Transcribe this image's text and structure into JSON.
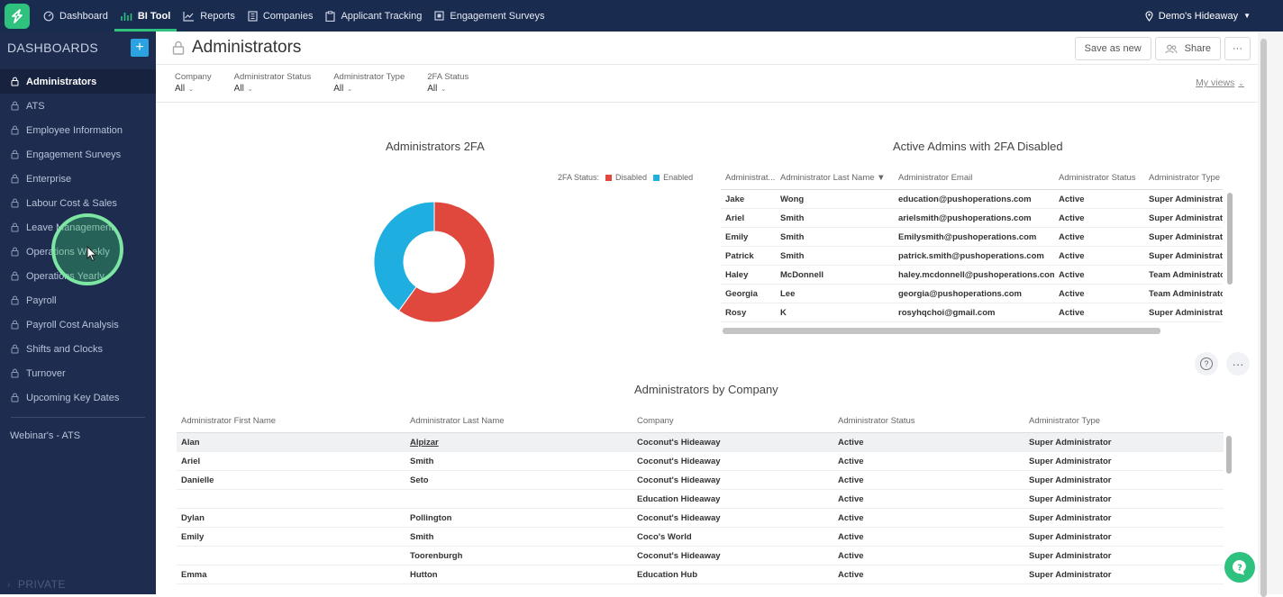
{
  "topbar": {
    "nav": [
      {
        "label": "Dashboard",
        "icon": "dashboard-icon"
      },
      {
        "label": "BI Tool",
        "icon": "bar-chart-icon",
        "active": true
      },
      {
        "label": "Reports",
        "icon": "line-chart-icon"
      },
      {
        "label": "Companies",
        "icon": "building-icon"
      },
      {
        "label": "Applicant Tracking",
        "icon": "clipboard-icon"
      },
      {
        "label": "Engagement Surveys",
        "icon": "survey-icon"
      }
    ],
    "org_label": "Demo's Hideaway"
  },
  "sidebar": {
    "title": "DASHBOARDS",
    "add_label": "+",
    "items": [
      {
        "label": "Administrators",
        "active": true
      },
      {
        "label": "ATS"
      },
      {
        "label": "Employee Information"
      },
      {
        "label": "Engagement Surveys"
      },
      {
        "label": "Enterprise"
      },
      {
        "label": "Labour Cost & Sales"
      },
      {
        "label": "Leave Management"
      },
      {
        "label": "Operations Weekly"
      },
      {
        "label": "Operations Yearly"
      },
      {
        "label": "Payroll"
      },
      {
        "label": "Payroll Cost Analysis"
      },
      {
        "label": "Shifts and Clocks"
      },
      {
        "label": "Turnover"
      },
      {
        "label": "Upcoming Key Dates"
      }
    ],
    "extra_item": "Webinar's - ATS",
    "private_label": "PRIVATE"
  },
  "header": {
    "title": "Administrators",
    "save_as_new": "Save as new",
    "share": "Share",
    "more": "···"
  },
  "filters": [
    {
      "label": "Company",
      "value": "All"
    },
    {
      "label": "Administrator Status",
      "value": "All"
    },
    {
      "label": "Administrator Type",
      "value": "All"
    },
    {
      "label": "2FA Status",
      "value": "All"
    }
  ],
  "my_views": "My views",
  "donut": {
    "title": "Administrators 2FA",
    "legend_title": "2FA Status:",
    "colors": {
      "Disabled": "#e0473d",
      "Enabled": "#1eaee0"
    }
  },
  "chart_data": {
    "type": "pie",
    "title": "Administrators 2FA",
    "legend_title": "2FA Status:",
    "series": [
      {
        "name": "Disabled",
        "value": 60
      },
      {
        "name": "Enabled",
        "value": 40
      }
    ],
    "donut": true,
    "legend": "top-right"
  },
  "active_admins": {
    "title": "Active Admins with 2FA Disabled",
    "columns": [
      "Administrat...",
      "Administrator Last Name ▼",
      "Administrator Email",
      "Administrator Status",
      "Administrator Type"
    ],
    "rows": [
      [
        "Jake",
        "Wong",
        "education@pushoperations.com",
        "Active",
        "Super Administrator"
      ],
      [
        "Ariel",
        "Smith",
        "arielsmith@pushoperations.com",
        "Active",
        "Super Administrator"
      ],
      [
        "Emily",
        "Smith",
        "Emilysmith@pushoperations.com",
        "Active",
        "Super Administrator"
      ],
      [
        "Patrick",
        "Smith",
        "patrick.smith@pushoperations.com",
        "Active",
        "Super Administrator"
      ],
      [
        "Haley",
        "McDonnell",
        "haley.mcdonnell@pushoperations.com",
        "Active",
        "Team Administrator"
      ],
      [
        "Georgia",
        "Lee",
        "georgia@pushoperations.com",
        "Active",
        "Team Administrator"
      ],
      [
        "Rosy",
        "K",
        "rosyhqchoi@gmail.com",
        "Active",
        "Super Administrator"
      ]
    ]
  },
  "by_company": {
    "title": "Administrators by Company",
    "columns": [
      "Administrator First Name",
      "Administrator Last Name",
      "Company",
      "Administrator Status",
      "Administrator Type"
    ],
    "rows": [
      [
        "Alan",
        "Alpizar",
        "Coconut's Hideaway",
        "Active",
        "Super Administrator"
      ],
      [
        "Ariel",
        "Smith",
        "Coconut's Hideaway",
        "Active",
        "Super Administrator"
      ],
      [
        "Danielle",
        "Seto",
        "Coconut's Hideaway",
        "Active",
        "Super Administrator"
      ],
      [
        "",
        "",
        "Education Hideaway",
        "Active",
        "Super Administrator"
      ],
      [
        "Dylan",
        "Pollington",
        "Coconut's Hideaway",
        "Active",
        "Super Administrator"
      ],
      [
        "Emily",
        "Smith",
        "Coco's World",
        "Active",
        "Super Administrator"
      ],
      [
        "",
        "Toorenburgh",
        "Coconut's Hideaway",
        "Active",
        "Super Administrator"
      ],
      [
        "Emma",
        "Hutton",
        "Education Hub",
        "Active",
        "Super Administrator"
      ]
    ]
  },
  "help_icon": "?",
  "more_icon": "···"
}
